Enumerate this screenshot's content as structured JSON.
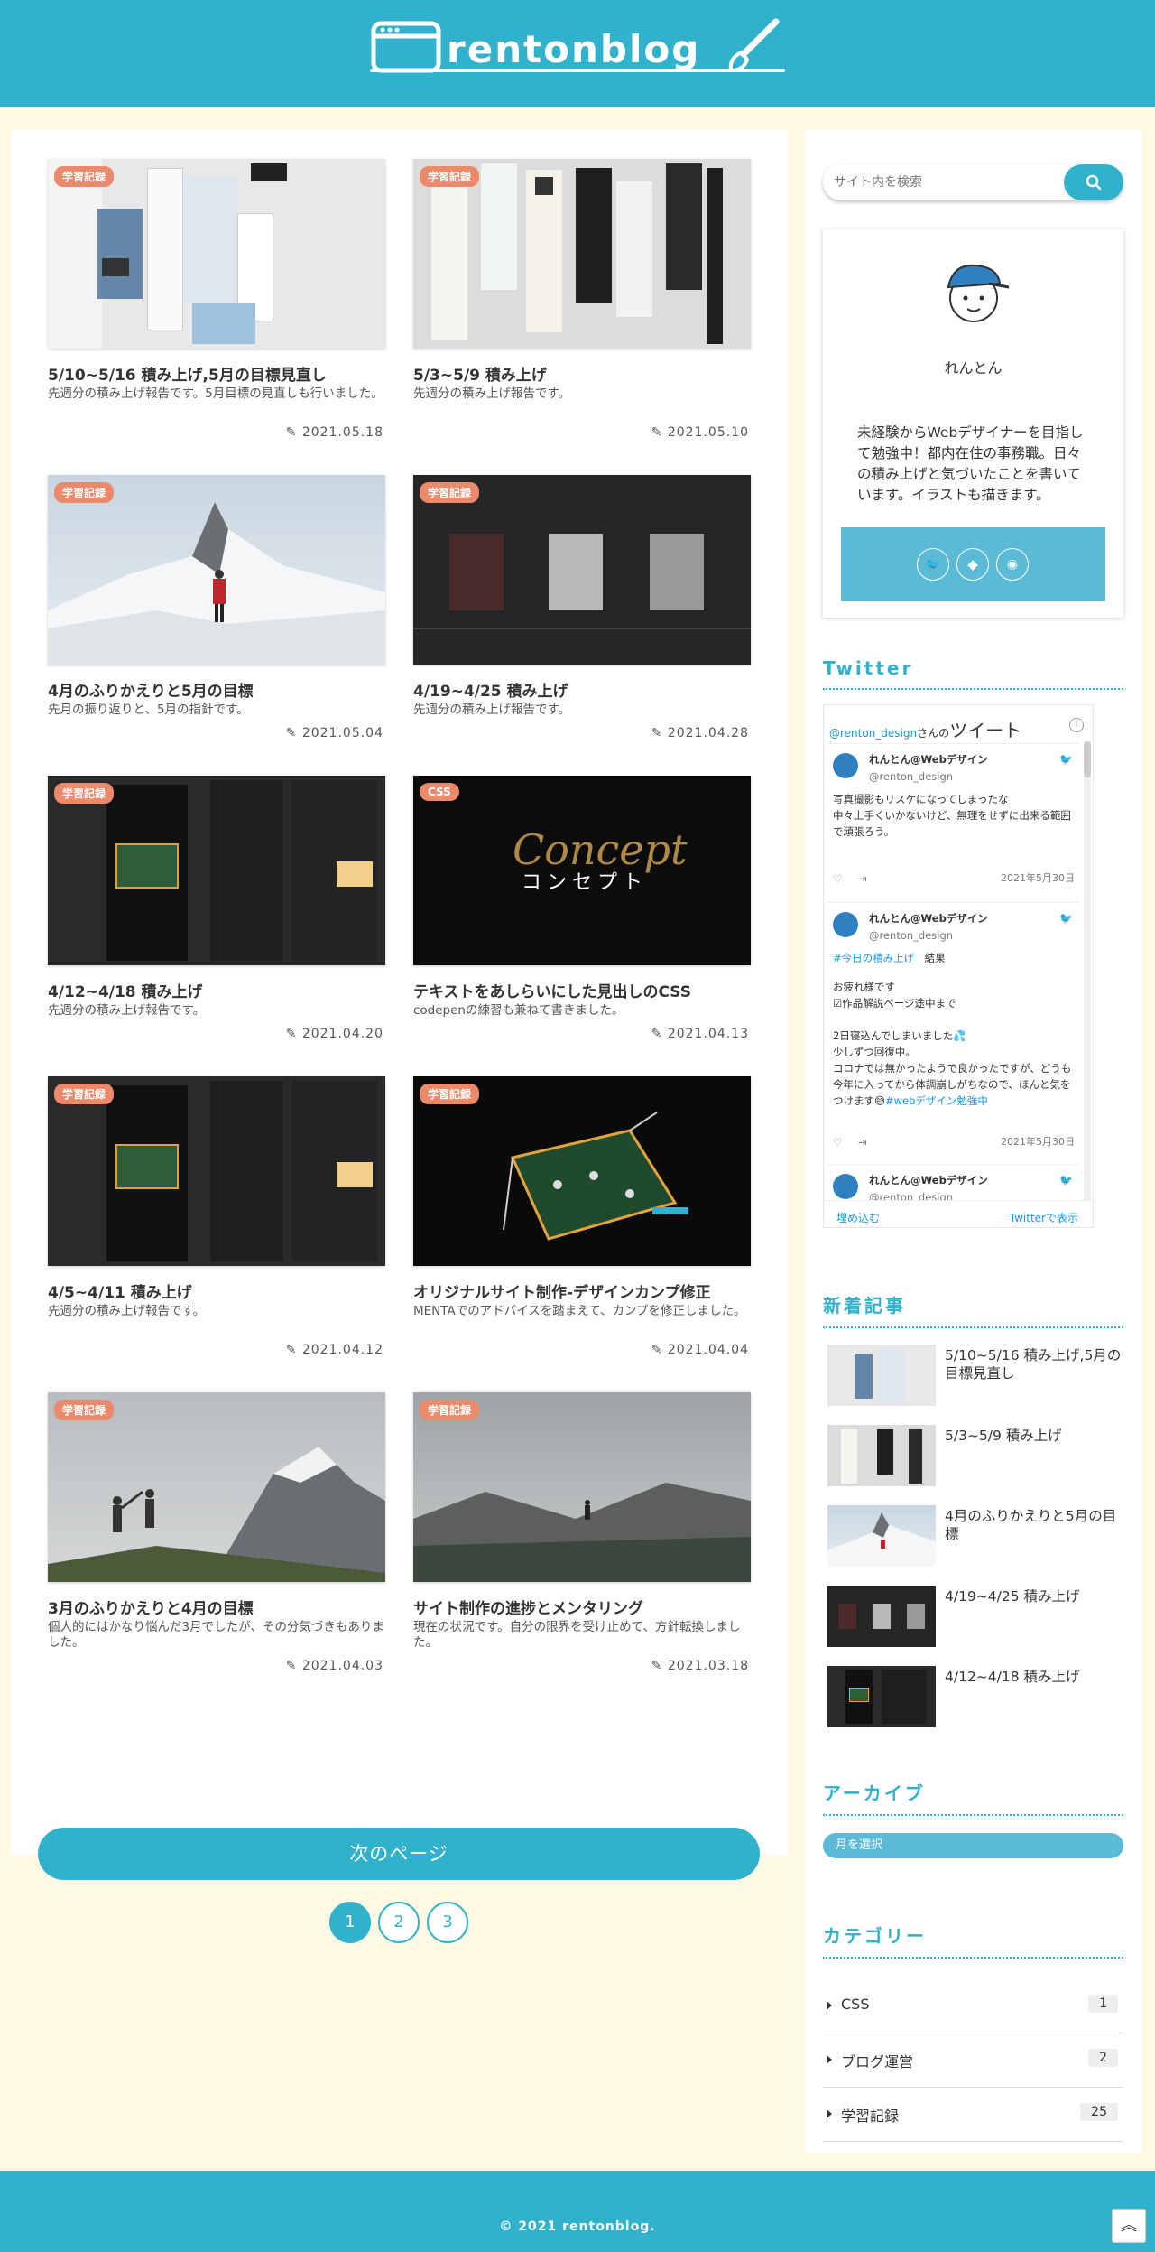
{
  "site": {
    "logo_text": "rentonblog",
    "footer": "© 2021 rentonblog."
  },
  "posts": [
    {
      "badge": "学習記録",
      "title": "5/10~5/16 積み上げ,5月の目標見直し",
      "excerpt": "先週分の積み上げ報告です。5月目標の見直しも行いました。",
      "date": "2021.05.18"
    },
    {
      "badge": "学習記録",
      "title": "5/3~5/9 積み上げ",
      "excerpt": "先週分の積み上げ報告です。",
      "date": "2021.05.10"
    },
    {
      "badge": "学習記録",
      "title": "4月のふりかえりと5月の目標",
      "excerpt": "先月の振り返りと、5月の指針です。",
      "date": "2021.05.04"
    },
    {
      "badge": "学習記録",
      "title": "4/19~4/25 積み上げ",
      "excerpt": "先週分の積み上げ報告です。",
      "date": "2021.04.28"
    },
    {
      "badge": "学習記録",
      "title": "4/12~4/18 積み上げ",
      "excerpt": "先週分の積み上げ報告です。",
      "date": "2021.04.20"
    },
    {
      "badge": "CSS",
      "title": "テキストをあしらいにした見出しのCSS",
      "excerpt": "codepenの練習も兼ねて書きました。",
      "date": "2021.04.13",
      "thumb_text": "コンセプト",
      "thumb_script": "Concept"
    },
    {
      "badge": "学習記録",
      "title": "4/5~4/11 積み上げ",
      "excerpt": "先週分の積み上げ報告です。",
      "date": "2021.04.12"
    },
    {
      "badge": "学習記録",
      "title": "オリジナルサイト制作-デザインカンプ修正",
      "excerpt": "MENTAでのアドバイスを踏まえて、カンプを修正しました。",
      "date": "2021.04.04"
    },
    {
      "badge": "学習記録",
      "title": "3月のふりかえりと4月の目標",
      "excerpt": "個人的にはかなり悩んだ3月でしたが、その分気づきもありました。",
      "date": "2021.04.03"
    },
    {
      "badge": "学習記録",
      "title": "サイト制作の進捗とメンタリング",
      "excerpt": "現在の状況です。自分の限界を受け止めて、方針転換しました。",
      "date": "2021.03.18"
    }
  ],
  "pagination": {
    "next_label": "次のページ",
    "pages": [
      "1",
      "2",
      "3"
    ]
  },
  "search": {
    "placeholder": "サイト内を検索"
  },
  "profile": {
    "name": "れんとん",
    "bio": "未経験からWebデザイナーを目指して勉強中！都内在住の事務職。日々の積み上げと気づいたことを書いています。イラストも描きます。"
  },
  "twitter": {
    "title": "Twitter",
    "handle_link": "@renton_design",
    "header_suffix": "さんの",
    "header_word": "ツイート",
    "tweets": [
      {
        "name": "れんとん@Webデザイン",
        "handle": "@renton_design",
        "body": "写真撮影もリスケになってしまったな\n中々上手くいかないけど、無理をせずに出来る範囲で頑張ろう。",
        "date": "2021年5月30日"
      },
      {
        "name": "れんとん@Webデザイン",
        "handle": "@renton_design",
        "hashtag": "#今日の積み上げ",
        "hashtag_suffix": "　結果",
        "body": "お疲れ様です\n☑作品解説ページ途中まで\n\n2日寝込んでしまいました💦\n少しずつ回復中。\nコロナでは無かったようで良かったですが、どうも今年に入ってから体調崩しがちなので、ほんと気をつけます😅",
        "hashtag2": "#webデザイン勉強中",
        "date": "2021年5月30日"
      },
      {
        "name": "れんとん@Webデザイン",
        "handle": "@renton_design"
      }
    ],
    "embed_label": "埋め込む",
    "view_label": "Twitterで表示"
  },
  "recent": {
    "title": "新着記事",
    "items": [
      "5/10~5/16 積み上げ,5月の目標見直し",
      "5/3~5/9 積み上げ",
      "4月のふりかえりと5月の目標",
      "4/19~4/25 積み上げ",
      "4/12~4/18 積み上げ"
    ]
  },
  "archive": {
    "title": "アーカイブ",
    "select_label": "月を選択"
  },
  "categories": {
    "title": "カテゴリー",
    "items": [
      {
        "label": "CSS",
        "count": "1"
      },
      {
        "label": "ブログ運営",
        "count": "2"
      },
      {
        "label": "学習記録",
        "count": "25"
      }
    ]
  },
  "colors": {
    "accent": "#31b2cc",
    "badge": "#ea8a6a",
    "background": "#fff8e3"
  }
}
